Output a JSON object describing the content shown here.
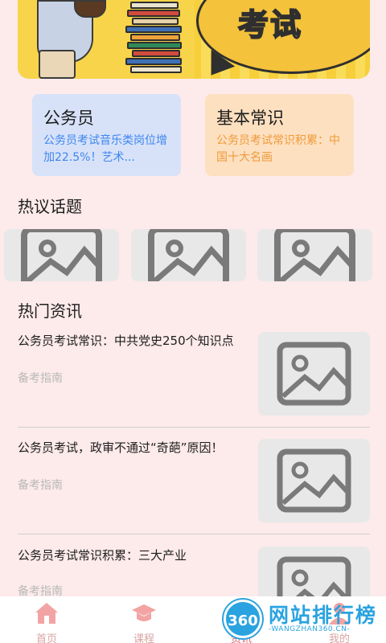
{
  "banner": {
    "text": "考试"
  },
  "cards": [
    {
      "title": "公务员",
      "desc": "公务员考试音乐类岗位增加22.5%！艺术..."
    },
    {
      "title": "基本常识",
      "desc": "公务员考试常识积累：中国十大名画"
    }
  ],
  "sections": {
    "topics_title": "热议话题",
    "news_title": "热门资讯"
  },
  "news": [
    {
      "title": "公务员考试常识：中共党史250个知识点",
      "tag": "备考指南"
    },
    {
      "title": "公务员考试，政审不通过“奇葩”原因！",
      "tag": "备考指南"
    },
    {
      "title": "公务员考试常识积累：三大产业",
      "tag": "备考指南"
    }
  ],
  "nav": {
    "items": [
      "首页",
      "课程",
      "资讯",
      "我的"
    ],
    "active": 2
  },
  "watermark": {
    "logo": "360",
    "name": "网站排行榜",
    "url": "-WANGZHAN360.CN-"
  },
  "colors": {
    "accent": "#e0676c",
    "blue": "#3f86ee",
    "orange": "#f09a3a",
    "background": "#fdeaea"
  }
}
